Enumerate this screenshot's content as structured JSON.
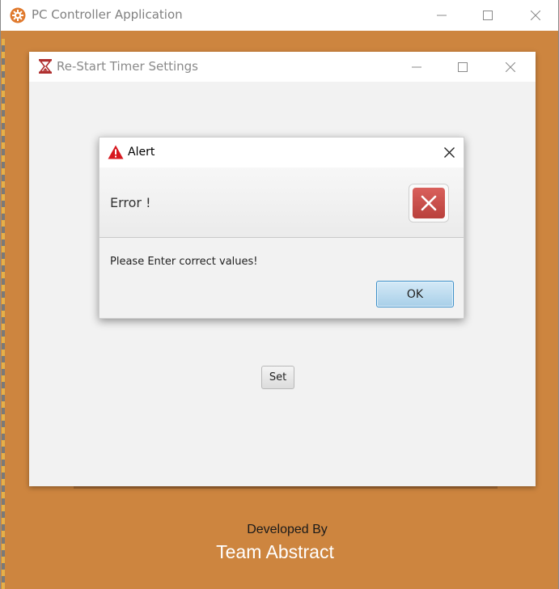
{
  "app_window": {
    "title": "PC Controller Application",
    "icon": "gear-icon",
    "accent_color": "#cd853f"
  },
  "timer_window": {
    "title": "Re-Start Timer Settings",
    "icon": "hourglass-icon",
    "set_label": "Set"
  },
  "alert": {
    "title": "Alert",
    "title_icon": "warning-icon",
    "header_text": "Error !",
    "header_icon": "error-x-icon",
    "content_text": "Please Enter correct values!",
    "ok_label": "OK",
    "error_color": "#c94f4b"
  },
  "footer": {
    "developed_by": "Developed By",
    "team_name": "Team Abstract"
  }
}
